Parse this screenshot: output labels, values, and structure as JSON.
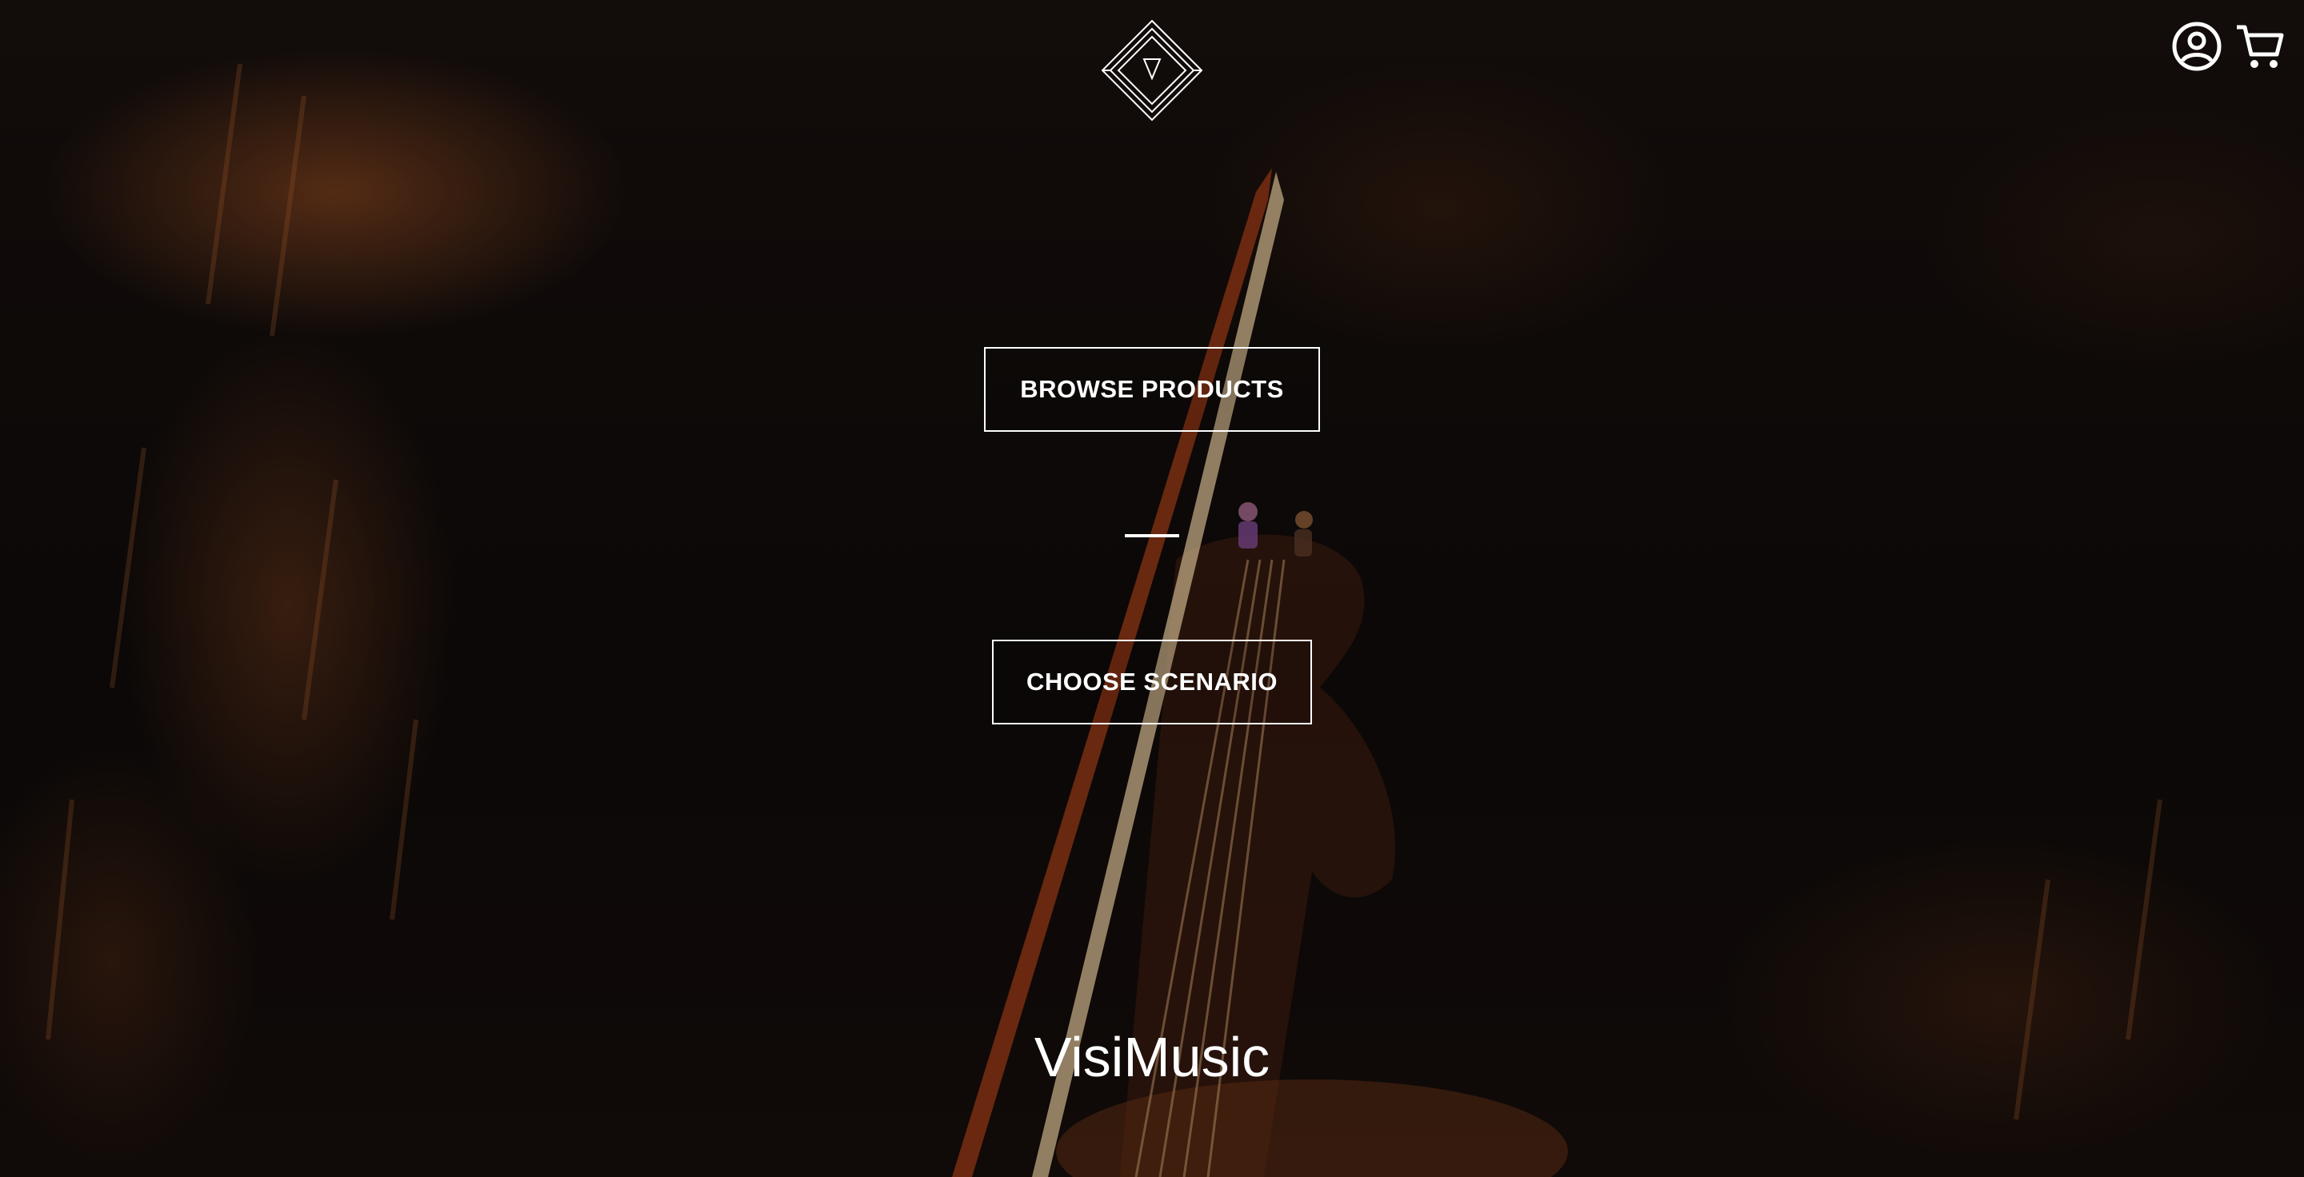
{
  "header": {
    "logo_icon": "diamond-triangle-logo-icon",
    "account_icon": "user-circle-icon",
    "cart_icon": "shopping-cart-icon"
  },
  "hero": {
    "browse_label": "BROWSE PRODUCTS",
    "scenario_label": "CHOOSE SCENARIO",
    "brand_name": "VisiMusic"
  },
  "colors": {
    "text": "#ffffff",
    "background": "#0b0807",
    "accent_wood": "#8a3f1f"
  }
}
